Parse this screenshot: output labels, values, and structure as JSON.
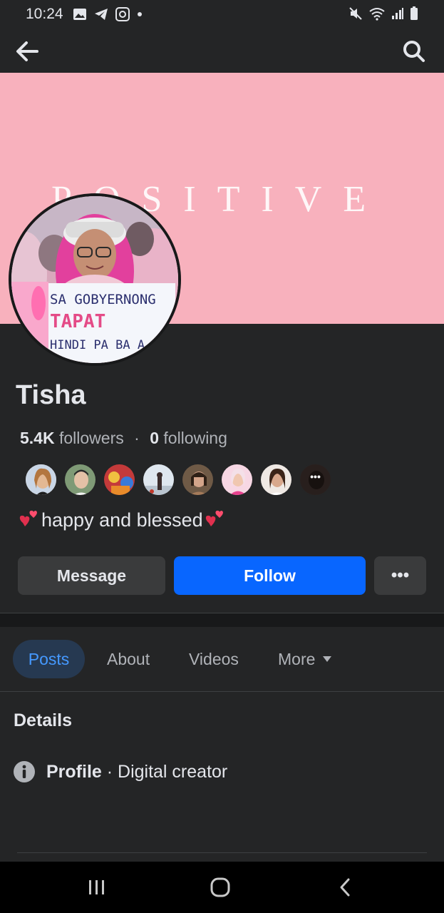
{
  "status_bar": {
    "time": "10:24",
    "left_icons": [
      "gallery-icon",
      "telegram-icon",
      "app-icon",
      "dot-icon"
    ],
    "right_icons": [
      "mute-icon",
      "wifi-icon",
      "signal-icon",
      "battery-icon"
    ]
  },
  "top_bar": {
    "back_icon": "arrow-left-icon",
    "search_icon": "search-icon"
  },
  "cover": {
    "text": "POSITIVE",
    "bg_color": "#f8b1bd"
  },
  "avatar": {
    "sign_line1": "SA GOBYERNONG",
    "sign_line2": "TAPAT",
    "sign_line3": "HINDI PA BA A"
  },
  "profile": {
    "name": "Tisha",
    "followers_count": "5.4K",
    "followers_label": "followers",
    "separator": "·",
    "following_count": "0",
    "following_label": "following",
    "bio": "happy and blessed",
    "friend_avatars": [
      "friend-1",
      "friend-2",
      "friend-3",
      "friend-4",
      "friend-5",
      "friend-6",
      "friend-7",
      "friend-more"
    ],
    "more_glyph": "•••"
  },
  "actions": {
    "message_label": "Message",
    "follow_label": "Follow",
    "more_label": "•••",
    "follow_color": "#0866ff"
  },
  "tabs": {
    "posts": "Posts",
    "about": "About",
    "videos": "Videos",
    "more": "More"
  },
  "details": {
    "title": "Details",
    "profile_label": "Profile",
    "profile_separator": " · ",
    "profile_value": "Digital creator"
  },
  "nav_bar": {
    "recents_icon": "recents-icon",
    "home_icon": "home-icon",
    "back_icon": "back-chevron-icon"
  }
}
